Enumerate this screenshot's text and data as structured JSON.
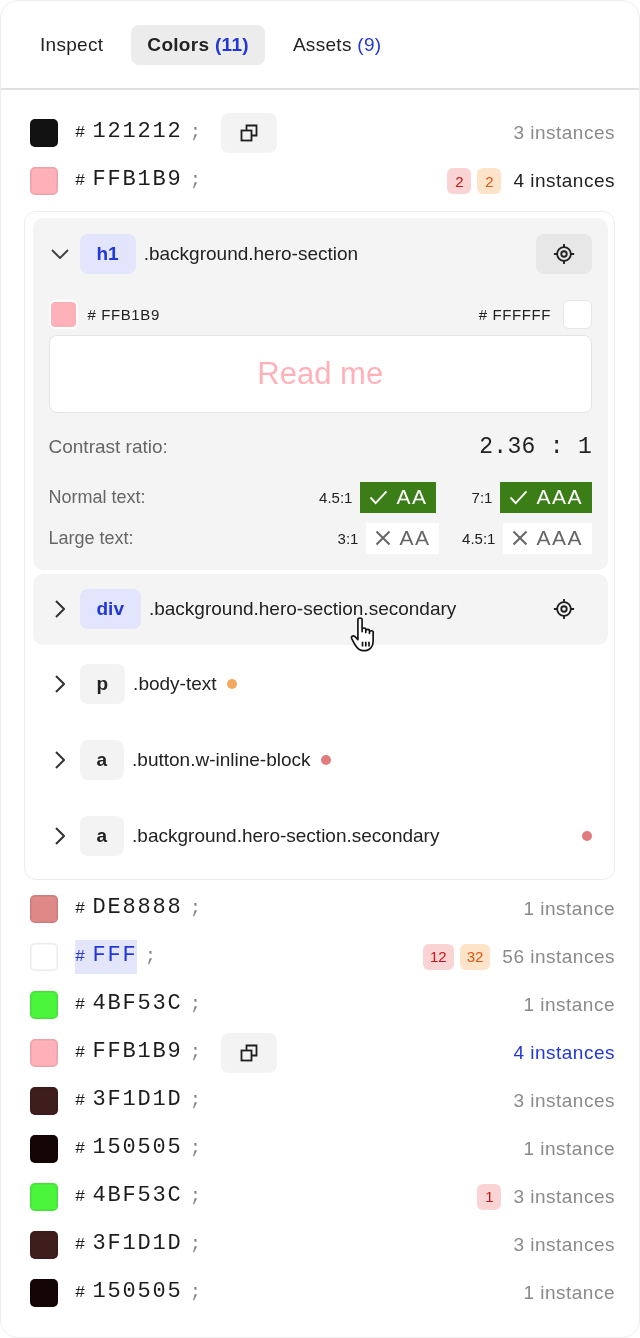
{
  "tabs": [
    {
      "label": "Inspect",
      "selected": false
    },
    {
      "label": "Colors",
      "count": "(11)",
      "selected": true
    },
    {
      "label": "Assets",
      "count": "(9)",
      "selected": false
    }
  ],
  "colors": [
    {
      "color": "#121212",
      "hash": "#",
      "code": "121212",
      "end": ";",
      "selected": false,
      "copy_button": true,
      "instances": "3 instances",
      "expanded": false,
      "highlighted": false
    },
    {
      "color": "#ffb1b9",
      "hash": "#",
      "code": "FFB1B9",
      "end": ";",
      "selected": false,
      "copy_button": false,
      "badges": [
        {
          "text": "2",
          "kind": "error"
        },
        {
          "text": "2",
          "kind": "warning"
        }
      ],
      "instances": "4 instances",
      "expanded": true,
      "highlighted": false,
      "elements": [
        {
          "tag": "h1",
          "selector": ".background.hero-section",
          "expanded": true,
          "hovered": false,
          "contrast": {
            "foreground": {
              "label": "# FFB1B9",
              "color": "#ffb1b9"
            },
            "background": {
              "label": "# FFFFFF",
              "color": "#ffffff"
            },
            "sample": "Read me",
            "ratio_label": "Contrast ratio:",
            "ratio": "2.36 : 1",
            "checks": [
              {
                "label": "Normal text:",
                "tests": [
                  {
                    "ratio": "4.5:1",
                    "level": "AA",
                    "passed": true
                  },
                  {
                    "ratio": "7:1",
                    "level": "AAA",
                    "passed": true
                  }
                ]
              },
              {
                "label": "Large text:",
                "tests": [
                  {
                    "ratio": "3:1",
                    "level": "AA",
                    "passed": false
                  },
                  {
                    "ratio": "4.5:1",
                    "level": "AAA",
                    "passed": false
                  }
                ]
              }
            ]
          }
        },
        {
          "tag": "div",
          "selector": ".background.hero-section.secondary",
          "expanded": false,
          "hovered": true
        },
        {
          "tag": "p",
          "selector": ".body-text",
          "expanded": false,
          "hovered": false,
          "color": "#f4a862",
          "kind": "inline"
        },
        {
          "tag": "a",
          "selector": ".button.w-inline-block",
          "expanded": false,
          "hovered": false,
          "color": "#e07c7c",
          "kind": "inline"
        },
        {
          "tag": "a",
          "selector": ".background.hero-section.secondary",
          "expanded": false,
          "hovered": false,
          "color": "#e07c7c",
          "kind": "end"
        }
      ]
    },
    {
      "color": "#de8888",
      "hash": "#",
      "code": "DE8888",
      "end": ";",
      "selected": false,
      "copy_button": false,
      "instances": "1 instance",
      "expanded": false,
      "highlighted": false
    },
    {
      "color": "#ffffff",
      "hash": "#",
      "code": "FFF",
      "end": ";",
      "selected": true,
      "copy_button": false,
      "badges": [
        {
          "text": "12",
          "kind": "error"
        },
        {
          "text": "32",
          "kind": "warning"
        }
      ],
      "instances": "56 instances",
      "expanded": false,
      "highlighted": false
    },
    {
      "color": "#4bf53c",
      "hash": "#",
      "code": "4BF53C",
      "end": ";",
      "selected": false,
      "copy_button": false,
      "instances": "1 instance",
      "expanded": false,
      "highlighted": false
    },
    {
      "color": "#ffb1b9",
      "hash": "#",
      "code": "FFB1B9",
      "end": ";",
      "selected": false,
      "copy_button": true,
      "instances": "4 instances",
      "expanded": false,
      "highlighted": true
    },
    {
      "color": "#3f1d1d",
      "hash": "#",
      "code": "3F1D1D",
      "end": ";",
      "selected": false,
      "copy_button": false,
      "instances": "3 instances",
      "expanded": false,
      "highlighted": false
    },
    {
      "color": "#150505",
      "hash": "#",
      "code": "150505",
      "end": ";",
      "selected": false,
      "copy_button": false,
      "instances": "1 instance",
      "expanded": false,
      "highlighted": false
    },
    {
      "color": "#4bf53c",
      "hash": "#",
      "code": "4BF53C",
      "end": ";",
      "selected": false,
      "copy_button": false,
      "badges": [
        {
          "text": "1",
          "kind": "error"
        }
      ],
      "instances": "3 instances",
      "expanded": false,
      "highlighted": false
    },
    {
      "color": "#3f1d1d",
      "hash": "#",
      "code": "3F1D1D",
      "end": ";",
      "selected": false,
      "copy_button": false,
      "instances": "3 instances",
      "expanded": false,
      "highlighted": false
    },
    {
      "color": "#150505",
      "hash": "#",
      "code": "150505",
      "end": ";",
      "selected": false,
      "copy_button": false,
      "instances": "1 instance",
      "expanded": false,
      "highlighted": false
    }
  ]
}
